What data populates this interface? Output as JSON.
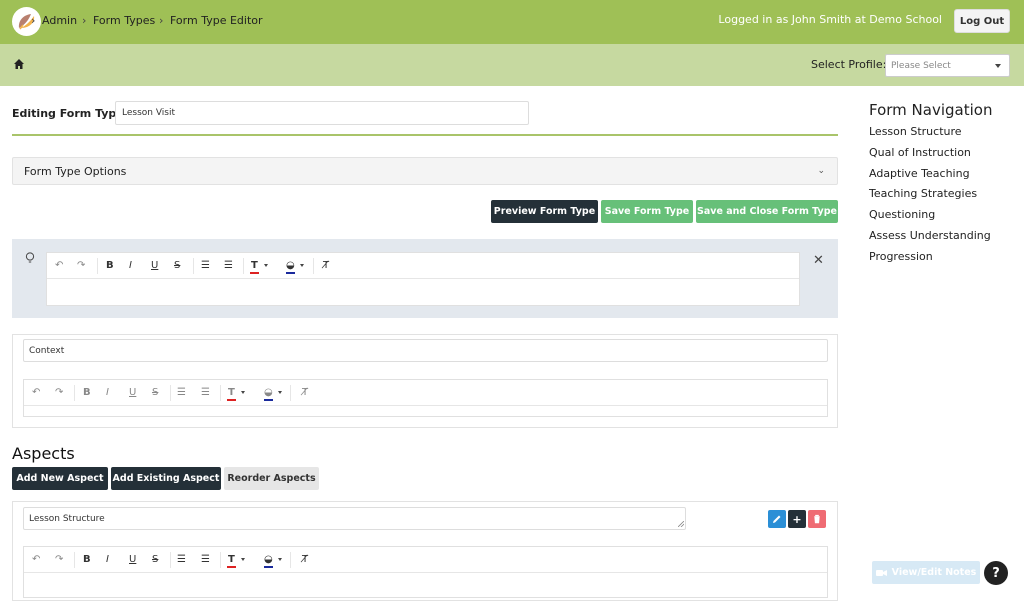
{
  "header": {
    "logged_in_text": "Logged in as John Smith at Demo School",
    "logout_label": "Log Out",
    "colors": {
      "topbar": "#9fc056",
      "crumbbar": "#c6d9a0"
    }
  },
  "breadcrumb": {
    "items": [
      "Admin",
      "Form Types",
      "Form Type Editor"
    ]
  },
  "profile": {
    "label": "Select Profile:",
    "placeholder": "Please Select"
  },
  "form": {
    "editing_label": "Editing Form Type:",
    "editing_value": "Lesson Visit",
    "options_label": "Form Type Options"
  },
  "actions": {
    "preview": "Preview Form Type",
    "save": "Save Form Type",
    "save_close": "Save and Close Form Type"
  },
  "context": {
    "value": "Context"
  },
  "aspects": {
    "title": "Aspects",
    "add_new": "Add New Aspect",
    "add_existing": "Add Existing Aspect",
    "reorder": "Reorder Aspects",
    "first_aspect": "Lesson Structure"
  },
  "nav": {
    "title": "Form Navigation",
    "items": [
      "Lesson Structure",
      "Qual of Instruction",
      "Adaptive Teaching",
      "Teaching Strategies",
      "Questioning",
      "Assess Understanding",
      "Progression"
    ]
  },
  "footer": {
    "notes_label": "View/Edit Notes",
    "help_label": "?"
  },
  "toolbar_icons": [
    "undo-icon",
    "redo-icon",
    "bold-icon",
    "italic-icon",
    "underline-icon",
    "strikethrough-icon",
    "numbered-list-icon",
    "bullet-list-icon",
    "text-color-icon",
    "highlight-color-icon",
    "clear-format-icon"
  ]
}
